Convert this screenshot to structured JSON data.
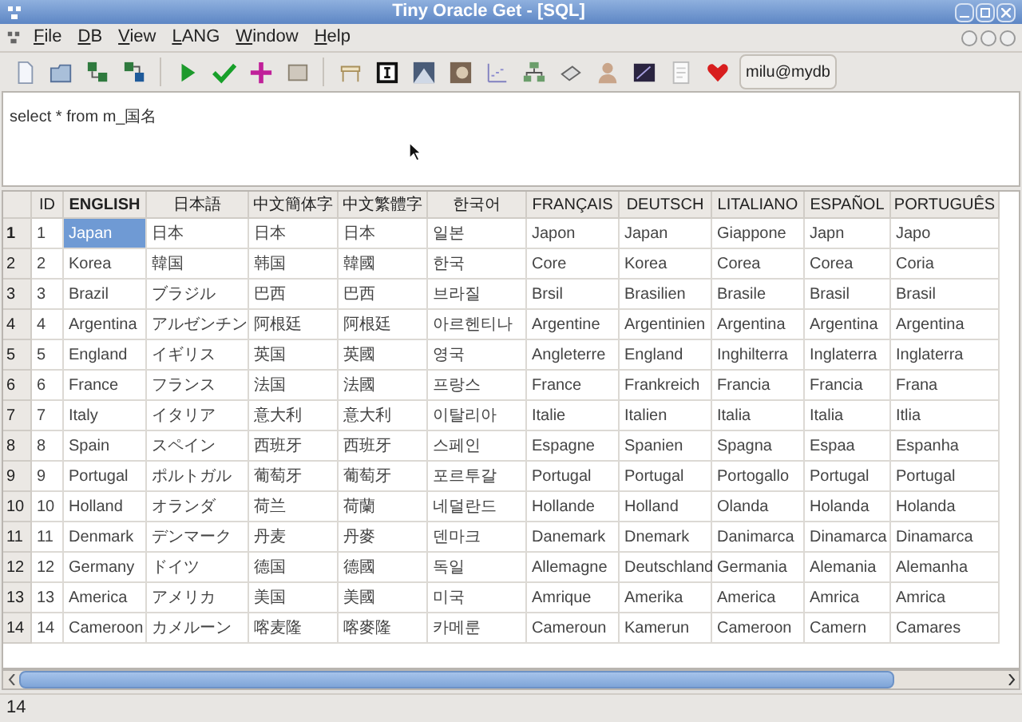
{
  "window": {
    "title": "Tiny Oracle Get - [SQL]"
  },
  "menu": [
    "File",
    "DB",
    "View",
    "LANG",
    "Window",
    "Help"
  ],
  "toolbar": {
    "connection": "milu@mydb"
  },
  "editor": {
    "value": "select * from m_国名"
  },
  "table": {
    "columns": [
      "ID",
      "ENGLISH",
      "日本語",
      "中文簡体字",
      "中文繁體字",
      "한국어",
      "FRANÇAIS",
      "DEUTSCH",
      "LITALIANO",
      "ESPAÑOL",
      "PORTUGUÊS"
    ],
    "rows": [
      {
        "number": "1",
        "cells": [
          {
            "text": "1",
            "selected": false
          },
          {
            "text": "Japan",
            "selected": true
          },
          {
            "text": "日本",
            "selected": false
          },
          {
            "text": "日本",
            "selected": false
          },
          {
            "text": "日本",
            "selected": false
          },
          {
            "text": "일본",
            "selected": false
          },
          {
            "text": "Japon",
            "selected": false
          },
          {
            "text": "Japan",
            "selected": false
          },
          {
            "text": "Giappone",
            "selected": false
          },
          {
            "text": "Japn",
            "selected": false
          },
          {
            "text": "Japo",
            "selected": false
          }
        ]
      },
      {
        "number": "2",
        "cells": [
          {
            "text": "2",
            "selected": false
          },
          {
            "text": "Korea",
            "selected": false
          },
          {
            "text": "韓国",
            "selected": false
          },
          {
            "text": "韩国",
            "selected": false
          },
          {
            "text": "韓國",
            "selected": false
          },
          {
            "text": "한국",
            "selected": false
          },
          {
            "text": "Core",
            "selected": false
          },
          {
            "text": "Korea",
            "selected": false
          },
          {
            "text": "Corea",
            "selected": false
          },
          {
            "text": "Corea",
            "selected": false
          },
          {
            "text": "Coria",
            "selected": false
          }
        ]
      },
      {
        "number": "3",
        "cells": [
          {
            "text": "3",
            "selected": false
          },
          {
            "text": "Brazil",
            "selected": false
          },
          {
            "text": "ブラジル",
            "selected": false
          },
          {
            "text": "巴西",
            "selected": false
          },
          {
            "text": "巴西",
            "selected": false
          },
          {
            "text": "브라질",
            "selected": false
          },
          {
            "text": "Brsil",
            "selected": false
          },
          {
            "text": "Brasilien",
            "selected": false
          },
          {
            "text": "Brasile",
            "selected": false
          },
          {
            "text": "Brasil",
            "selected": false
          },
          {
            "text": "Brasil",
            "selected": false
          }
        ]
      },
      {
        "number": "4",
        "cells": [
          {
            "text": "4",
            "selected": false
          },
          {
            "text": "Argentina",
            "selected": false
          },
          {
            "text": "アルゼンチン",
            "selected": false
          },
          {
            "text": "阿根廷",
            "selected": false
          },
          {
            "text": "阿根廷",
            "selected": false
          },
          {
            "text": "아르헨티나",
            "selected": false
          },
          {
            "text": "Argentine",
            "selected": false
          },
          {
            "text": "Argentinien",
            "selected": false
          },
          {
            "text": "Argentina",
            "selected": false
          },
          {
            "text": "Argentina",
            "selected": false
          },
          {
            "text": "Argentina",
            "selected": false
          }
        ]
      },
      {
        "number": "5",
        "cells": [
          {
            "text": "5",
            "selected": false
          },
          {
            "text": "England",
            "selected": false
          },
          {
            "text": "イギリス",
            "selected": false
          },
          {
            "text": "英国",
            "selected": false
          },
          {
            "text": "英國",
            "selected": false
          },
          {
            "text": "영국",
            "selected": false
          },
          {
            "text": "Angleterre",
            "selected": false
          },
          {
            "text": "England",
            "selected": false
          },
          {
            "text": "Inghilterra",
            "selected": false
          },
          {
            "text": "Inglaterra",
            "selected": false
          },
          {
            "text": "Inglaterra",
            "selected": false
          }
        ]
      },
      {
        "number": "6",
        "cells": [
          {
            "text": "6",
            "selected": false
          },
          {
            "text": "France",
            "selected": false
          },
          {
            "text": "フランス",
            "selected": false
          },
          {
            "text": "法国",
            "selected": false
          },
          {
            "text": "法國",
            "selected": false
          },
          {
            "text": "프랑스",
            "selected": false
          },
          {
            "text": "France",
            "selected": false
          },
          {
            "text": "Frankreich",
            "selected": false
          },
          {
            "text": "Francia",
            "selected": false
          },
          {
            "text": "Francia",
            "selected": false
          },
          {
            "text": "Frana",
            "selected": false
          }
        ]
      },
      {
        "number": "7",
        "cells": [
          {
            "text": "7",
            "selected": false
          },
          {
            "text": "Italy",
            "selected": false
          },
          {
            "text": "イタリア",
            "selected": false
          },
          {
            "text": "意大利",
            "selected": false
          },
          {
            "text": "意大利",
            "selected": false
          },
          {
            "text": "이탈리아",
            "selected": false
          },
          {
            "text": "Italie",
            "selected": false
          },
          {
            "text": "Italien",
            "selected": false
          },
          {
            "text": "Italia",
            "selected": false
          },
          {
            "text": "Italia",
            "selected": false
          },
          {
            "text": "Itlia",
            "selected": false
          }
        ]
      },
      {
        "number": "8",
        "cells": [
          {
            "text": "8",
            "selected": false
          },
          {
            "text": "Spain",
            "selected": false
          },
          {
            "text": "スペイン",
            "selected": false
          },
          {
            "text": "西班牙",
            "selected": false
          },
          {
            "text": "西班牙",
            "selected": false
          },
          {
            "text": "스페인",
            "selected": false
          },
          {
            "text": "Espagne",
            "selected": false
          },
          {
            "text": "Spanien",
            "selected": false
          },
          {
            "text": "Spagna",
            "selected": false
          },
          {
            "text": "Espaa",
            "selected": false
          },
          {
            "text": "Espanha",
            "selected": false
          }
        ]
      },
      {
        "number": "9",
        "cells": [
          {
            "text": "9",
            "selected": false
          },
          {
            "text": "Portugal",
            "selected": false
          },
          {
            "text": "ポルトガル",
            "selected": false
          },
          {
            "text": "葡萄牙",
            "selected": false
          },
          {
            "text": "葡萄牙",
            "selected": false
          },
          {
            "text": "포르투갈",
            "selected": false
          },
          {
            "text": "Portugal",
            "selected": false
          },
          {
            "text": "Portugal",
            "selected": false
          },
          {
            "text": "Portogallo",
            "selected": false
          },
          {
            "text": "Portugal",
            "selected": false
          },
          {
            "text": "Portugal",
            "selected": false
          }
        ]
      },
      {
        "number": "10",
        "cells": [
          {
            "text": "10",
            "selected": false
          },
          {
            "text": "Holland",
            "selected": false
          },
          {
            "text": "オランダ",
            "selected": false
          },
          {
            "text": "荷兰",
            "selected": false
          },
          {
            "text": "荷蘭",
            "selected": false
          },
          {
            "text": "네덜란드",
            "selected": false
          },
          {
            "text": "Hollande",
            "selected": false
          },
          {
            "text": "Holland",
            "selected": false
          },
          {
            "text": "Olanda",
            "selected": false
          },
          {
            "text": "Holanda",
            "selected": false
          },
          {
            "text": "Holanda",
            "selected": false
          }
        ]
      },
      {
        "number": "11",
        "cells": [
          {
            "text": "11",
            "selected": false
          },
          {
            "text": "Denmark",
            "selected": false
          },
          {
            "text": "デンマーク",
            "selected": false
          },
          {
            "text": "丹麦",
            "selected": false
          },
          {
            "text": "丹麥",
            "selected": false
          },
          {
            "text": "덴마크",
            "selected": false
          },
          {
            "text": "Danemark",
            "selected": false
          },
          {
            "text": "Dnemark",
            "selected": false
          },
          {
            "text": "Danimarca",
            "selected": false
          },
          {
            "text": "Dinamarca",
            "selected": false
          },
          {
            "text": "Dinamarca",
            "selected": false
          }
        ]
      },
      {
        "number": "12",
        "cells": [
          {
            "text": "12",
            "selected": false
          },
          {
            "text": "Germany",
            "selected": false
          },
          {
            "text": "ドイツ",
            "selected": false
          },
          {
            "text": "德国",
            "selected": false
          },
          {
            "text": "德國",
            "selected": false
          },
          {
            "text": "독일",
            "selected": false
          },
          {
            "text": "Allemagne",
            "selected": false
          },
          {
            "text": "Deutschland",
            "selected": false
          },
          {
            "text": "Germania",
            "selected": false
          },
          {
            "text": "Alemania",
            "selected": false
          },
          {
            "text": "Alemanha",
            "selected": false
          }
        ]
      },
      {
        "number": "13",
        "cells": [
          {
            "text": "13",
            "selected": false
          },
          {
            "text": "America",
            "selected": false
          },
          {
            "text": "アメリカ",
            "selected": false
          },
          {
            "text": "美国",
            "selected": false
          },
          {
            "text": "美國",
            "selected": false
          },
          {
            "text": "미국",
            "selected": false
          },
          {
            "text": "Amrique",
            "selected": false
          },
          {
            "text": "Amerika",
            "selected": false
          },
          {
            "text": "America",
            "selected": false
          },
          {
            "text": "Amrica",
            "selected": false
          },
          {
            "text": "Amrica",
            "selected": false
          }
        ]
      },
      {
        "number": "14",
        "cells": [
          {
            "text": "14",
            "selected": false
          },
          {
            "text": "Cameroon",
            "selected": false
          },
          {
            "text": "カメルーン",
            "selected": false
          },
          {
            "text": "喀麦隆",
            "selected": false
          },
          {
            "text": "喀麥隆",
            "selected": false
          },
          {
            "text": "카메룬",
            "selected": false
          },
          {
            "text": "Cameroun",
            "selected": false
          },
          {
            "text": "Kamerun",
            "selected": false
          },
          {
            "text": "Cameroon",
            "selected": false
          },
          {
            "text": "Camern",
            "selected": false
          },
          {
            "text": "Camares",
            "selected": false
          }
        ]
      }
    ]
  },
  "status_bar": {
    "count": "14"
  }
}
